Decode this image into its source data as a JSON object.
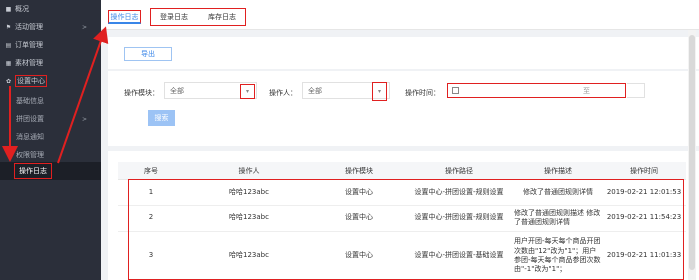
{
  "sidebar": {
    "items": [
      {
        "label": "概况",
        "icon": "home-icon"
      },
      {
        "label": "活动管理",
        "icon": "flag-icon",
        "arrow": ">"
      },
      {
        "label": "订单管理",
        "icon": "document-icon"
      },
      {
        "label": "素材管理",
        "icon": "image-icon"
      },
      {
        "label": "设置中心",
        "icon": "gear-icon"
      }
    ],
    "sub_items": [
      {
        "label": "基础信息"
      },
      {
        "label": "拼团设置",
        "arrow": ">"
      },
      {
        "label": "消息通知"
      },
      {
        "label": "权限管理"
      },
      {
        "label": "操作日志"
      }
    ]
  },
  "tabs": [
    {
      "label": "操作日志"
    },
    {
      "label": "登录日志"
    },
    {
      "label": "库存日志"
    }
  ],
  "toolbar": {
    "export_label": "导出"
  },
  "filters": {
    "module_label": "操作模块：",
    "module_value": "全部",
    "operator_label": "操作人：",
    "operator_value": "全部",
    "time_label": "操作时间：",
    "time_separator": "至",
    "caret": "▾",
    "search_label": "搜索"
  },
  "table": {
    "headers": [
      "序号",
      "操作人",
      "操作模块",
      "操作路径",
      "操作描述",
      "操作时间"
    ],
    "rows": [
      {
        "no": "1",
        "operator": "哈哈123abc",
        "module": "设置中心",
        "path": "设置中心-拼团设置-规则设置",
        "desc": "修改了普通团规则详情",
        "time": "2019-02-21 12:01:53"
      },
      {
        "no": "2",
        "operator": "哈哈123abc",
        "module": "设置中心",
        "path": "设置中心-拼团设置-规则设置",
        "desc": "修改了普通团规则描述 修改了普通团规则详情",
        "time": "2019-02-21 11:54:23"
      },
      {
        "no": "3",
        "operator": "哈哈123abc",
        "module": "设置中心",
        "path": "设置中心-拼团设置-基础设置",
        "desc": "用户开团-每天每个商品开团次数由\"12\"改为\"1\"；用户参团-每天每个商品参团次数由\"-1\"改为\"1\"；",
        "time": "2019-02-21 11:01:33"
      }
    ]
  },
  "colors": {
    "sidebar_bg": "#2b2f3a",
    "annotation": "#e02020",
    "accent": "#3a86e8"
  }
}
